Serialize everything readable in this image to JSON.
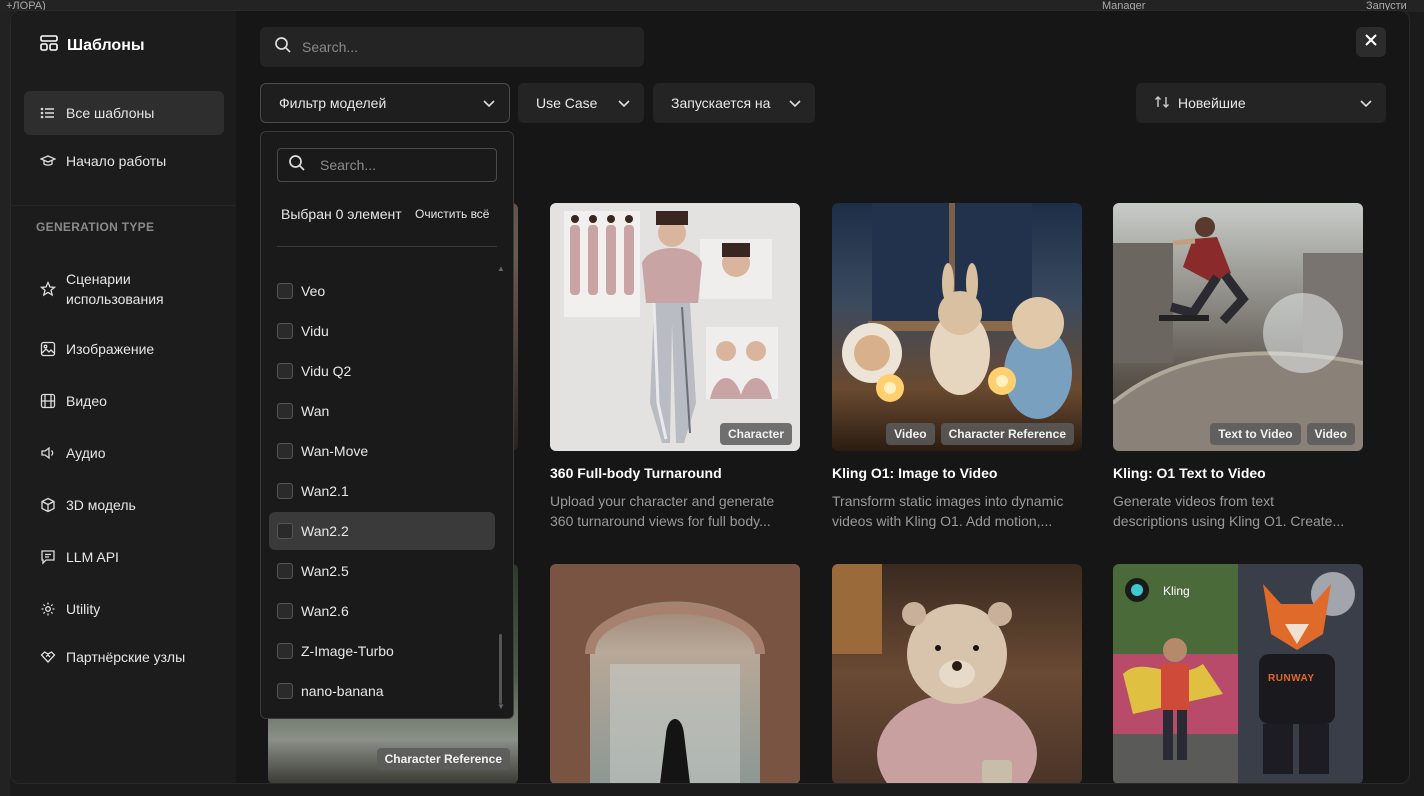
{
  "background": {
    "tab_left": "+ЛОРА)",
    "tab_right_1": "Manager",
    "tab_right_2": "Запусти"
  },
  "sidebar": {
    "brand": "Шаблоны",
    "items_top": [
      {
        "label": "Все шаблоны",
        "icon": "list-icon",
        "active": true
      },
      {
        "label": "Начало работы",
        "icon": "graduation-cap-icon"
      }
    ],
    "section_title": "GENERATION TYPE",
    "items": [
      {
        "label": "Сценарии использования",
        "icon": "star-icon"
      },
      {
        "label": "Изображение",
        "icon": "image-icon"
      },
      {
        "label": "Видео",
        "icon": "film-icon"
      },
      {
        "label": "Аудио",
        "icon": "speaker-icon"
      },
      {
        "label": "3D модель",
        "icon": "cube-icon"
      },
      {
        "label": "LLM API",
        "icon": "message-icon"
      },
      {
        "label": "Utility",
        "icon": "gear-icon"
      },
      {
        "label": "Партнёрские узлы",
        "icon": "handshake-icon"
      }
    ]
  },
  "search": {
    "placeholder": "Search..."
  },
  "filters": {
    "model_filter": "Фильтр моделей",
    "use_case": "Use Case",
    "runs_on": "Запускается на",
    "sort": "Новейшие"
  },
  "dropdown": {
    "search_placeholder": "Search...",
    "selected_text": "Выбран 0 элемент",
    "clear_all": "Очистить всё",
    "options": [
      "Veo",
      "Vidu",
      "Vidu Q2",
      "Wan",
      "Wan-Move",
      "Wan2.1",
      "Wan2.2",
      "Wan2.5",
      "Wan2.6",
      "Z-Image-Turbo",
      "nano-banana"
    ],
    "hovered": "Wan2.2"
  },
  "cards": [
    {
      "title": "360 Full-body Turnaround",
      "desc1": "Upload your character and generate",
      "desc2": "360 turnaround views for full body...",
      "tags": [
        "Character"
      ]
    },
    {
      "title": "Kling O1: Image to Video",
      "desc1": "Transform static images into dynamic",
      "desc2": "videos with Kling O1. Add motion,...",
      "tags": [
        "Video",
        "Character Reference"
      ]
    },
    {
      "title": "Kling: O1 Text to Video",
      "desc1": "Generate videos from text",
      "desc2": "descriptions using Kling O1. Create...",
      "tags": [
        "Text to Video",
        "Video"
      ]
    }
  ],
  "partial_card_tag": "Character Reference",
  "row2_overlay_text": "Kling",
  "row2_shirt_text": "RUNWAY"
}
